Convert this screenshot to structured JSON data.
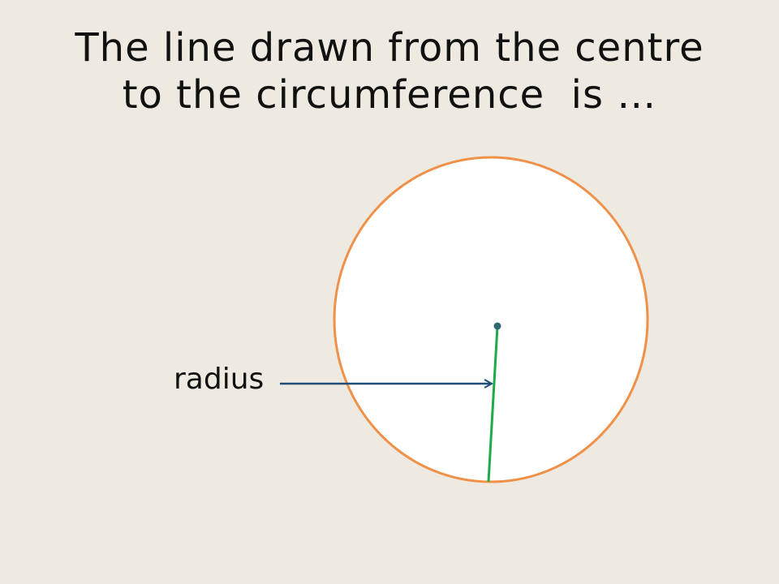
{
  "slide": {
    "title_line_1": "The line drawn from the centre",
    "title_line_2": "to the circumference  is …",
    "radius_label": "radius"
  },
  "colors": {
    "background": "#EEEAE1",
    "circle_outline": "#F0914A",
    "circle_fill": "#FFFFFF",
    "radius_line": "#1DAB48",
    "arrow": "#1F4E79",
    "centre_dot": "#2E6B73"
  }
}
